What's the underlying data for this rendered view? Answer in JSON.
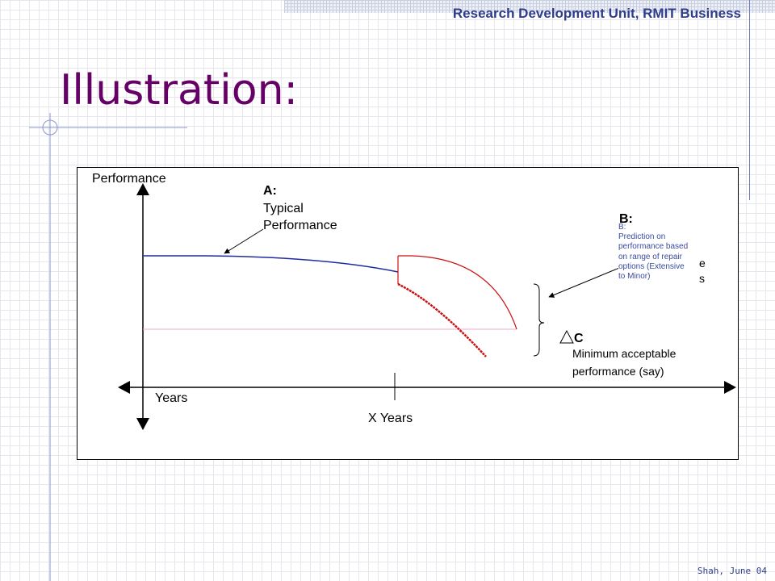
{
  "header": {
    "text": "Research Development Unit, RMIT Business"
  },
  "title": "Illustration:",
  "footer": "Shah, June 04",
  "diagram": {
    "y_axis_label": "Performance",
    "x_axis_label": "Years",
    "x_mark_label": "X Years",
    "label_a": {
      "letter": "A:",
      "line1": "Typical",
      "line2": "Performance"
    },
    "label_b_heading": "B:",
    "label_b_partial": {
      "line1": "e",
      "line2": "s"
    },
    "label_c": {
      "letter": "C",
      "line1": "Minimum acceptable",
      "line2": "performance (say)"
    },
    "callout_b": {
      "heading": "B:",
      "body": "Prediction on performance based on range of repair options (Extensive to Minor)"
    },
    "colors": {
      "typical": "#1f2b9e",
      "prediction": "#cc1111",
      "threshold": "#f2a8c8",
      "title": "#660066",
      "header": "#2e3d8a"
    }
  }
}
